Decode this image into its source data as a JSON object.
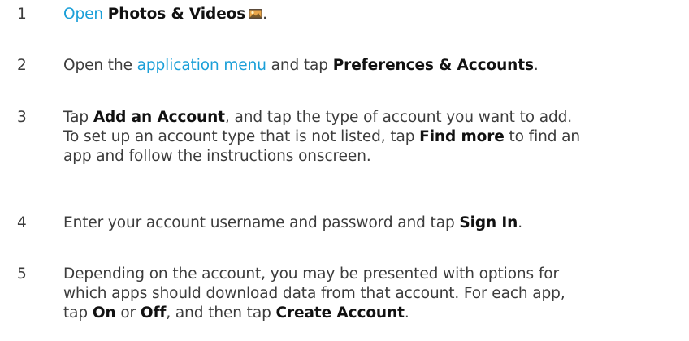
{
  "steps": [
    {
      "number": "1",
      "link": "Open",
      "bold": "Photos & Videos",
      "tail": "."
    },
    {
      "number": "2",
      "pre": "Open the",
      "link": "application menu",
      "mid": "and tap",
      "bold": "Preferences & Accounts",
      "tail": "."
    },
    {
      "number": "3",
      "pre": "Tap",
      "bold1": "Add an Account",
      "line1_rest": ", and tap the type of account you want to add.",
      "line2_pre": "To set up an account type that is not listed, tap",
      "bold2": "Find more",
      "line2_rest": "to find an",
      "line3": "app and follow the instructions onscreen."
    },
    {
      "number": "4",
      "pre": "Enter your account username and password and tap",
      "bold": "Sign In",
      "tail": "."
    },
    {
      "number": "5",
      "line1": "Depending on the account, you may be presented with options for",
      "line2": "which apps should download data from that account. For each app,",
      "pre": "tap",
      "bold1": "On",
      "or": "or",
      "bold2": "Off",
      "mid": ", and then tap",
      "bold3": "Create Account",
      "tail": "."
    }
  ],
  "icons": {
    "photos_icon": "photos-videos-icon"
  }
}
